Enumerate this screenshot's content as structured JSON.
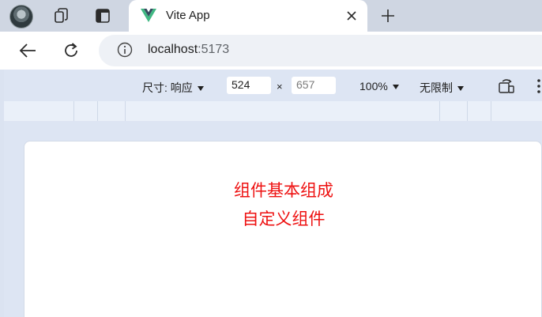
{
  "tab": {
    "title": "Vite App"
  },
  "address_bar": {
    "host": "localhost",
    "port": ":5173"
  },
  "device_toolbar": {
    "size_label": "尺寸: 响应",
    "width": "524",
    "height_placeholder": "657",
    "times": "×",
    "zoom": "100%",
    "throttle": "无限制"
  },
  "page": {
    "line1": "组件基本组成",
    "line2": "自定义组件"
  },
  "icons": {
    "profile": "avatar",
    "workspaces": "workspaces-icon",
    "tab_actions": "tab-actions-icon",
    "vue_logo": "vue-logo-icon",
    "close": "close-icon",
    "new_tab": "plus-icon",
    "back": "back-arrow-icon",
    "reload": "reload-icon",
    "site_info": "info-icon",
    "rotate": "rotate-icon",
    "more": "more-vertical-icon"
  },
  "colors": {
    "page_text": "#ee1111",
    "vue_green": "#41b883",
    "vue_dark": "#35495e"
  }
}
